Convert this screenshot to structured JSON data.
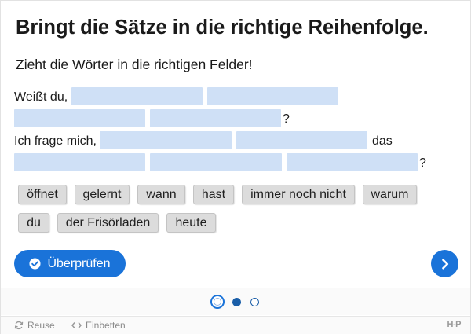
{
  "task": {
    "title": "Bringt die Sätze in die richtige Reihenfolge.",
    "instruction": "Zieht die Wörter in die richtigen Felder!"
  },
  "sentences": {
    "s1_prefix": "Weißt du,",
    "s1_end": "?",
    "s2_prefix": "Ich frage mich,",
    "s2_middle": "das",
    "s2_end": "?"
  },
  "word_bank": [
    "öffnet",
    "gelernt",
    "wann",
    "hast",
    "immer noch nicht",
    "warum",
    "du",
    "der Frisörladen",
    "heute"
  ],
  "buttons": {
    "check_label": "Überprüfen",
    "check_icon": "check-circle-icon",
    "next_icon": "chevron-right-icon"
  },
  "pagination": {
    "pages": 3,
    "current": 1
  },
  "footer": {
    "reuse_label": "Reuse",
    "embed_label": "Einbetten",
    "logo_text": "H-P"
  },
  "colors": {
    "accent": "#1a73d9",
    "dropzone": "#cfe0f6",
    "chip": "#dcdcdc"
  }
}
